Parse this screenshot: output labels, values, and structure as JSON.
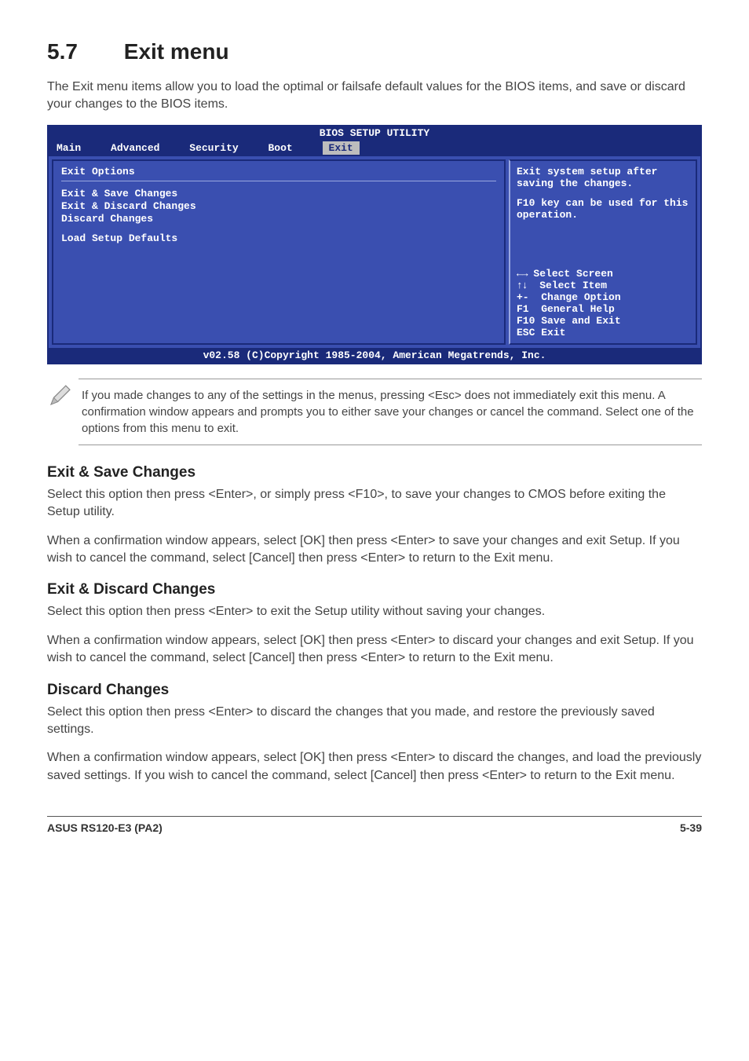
{
  "section": {
    "number": "5.7",
    "title": "Exit menu"
  },
  "intro": "The Exit menu items allow you to load the optimal or failsafe default values for the BIOS items, and save or discard your changes to the BIOS items.",
  "bios": {
    "title": "BIOS SETUP UTILITY",
    "tabs": {
      "main": "Main",
      "advanced": "Advanced",
      "security": "Security",
      "boot": "Boot",
      "exit": "Exit"
    },
    "left": {
      "heading": "Exit Options",
      "opt1": "Exit & Save Changes",
      "opt2": "Exit & Discard Changes",
      "opt3": "Discard Changes",
      "opt4": "Load Setup Defaults"
    },
    "help": {
      "line1": "Exit system setup after saving the changes.",
      "line2": "F10 key can be used for this operation."
    },
    "keys": {
      "k1": "Select Screen",
      "k2": "Select Item",
      "k3": "Change Option",
      "k4": "General Help",
      "k5": "Save and Exit",
      "k6": "Exit",
      "p1": "←→",
      "p2": "↑↓",
      "p3": "+-",
      "p4": "F1",
      "p5": "F10",
      "p6": "ESC"
    },
    "footer": "v02.58 (C)Copyright 1985-2004, American Megatrends, Inc."
  },
  "note": "If you made changes to any of the settings in the menus, pressing <Esc> does not immediately exit this menu. A confirmation window appears and prompts you to either save your changes or cancel the command. Select one of the options from this menu to exit.",
  "sub1": {
    "title": "Exit & Save Changes",
    "p1": "Select this option then press <Enter>, or simply press <F10>, to save your changes to CMOS before exiting the Setup utility.",
    "p2": "When a confirmation window appears, select [OK] then press <Enter> to save your changes and exit Setup. If you wish to cancel the command, select [Cancel] then press <Enter> to return to the Exit menu."
  },
  "sub2": {
    "title": "Exit & Discard Changes",
    "p1": "Select this option then press <Enter> to exit the Setup utility without saving your changes.",
    "p2": "When a confirmation window appears, select [OK] then press <Enter> to discard your changes and exit Setup. If you wish to cancel the command, select [Cancel] then press <Enter> to return to the Exit menu."
  },
  "sub3": {
    "title": "Discard Changes",
    "p1": "Select this option then press <Enter> to discard the changes that you made, and restore the previously saved settings.",
    "p2": "When a confirmation window appears, select [OK] then press <Enter> to discard the changes, and load the previously saved settings. If you wish to cancel the command, select [Cancel] then press <Enter> to return to the Exit menu."
  },
  "footer": {
    "left": "ASUS RS120-E3 (PA2)",
    "right": "5-39"
  }
}
